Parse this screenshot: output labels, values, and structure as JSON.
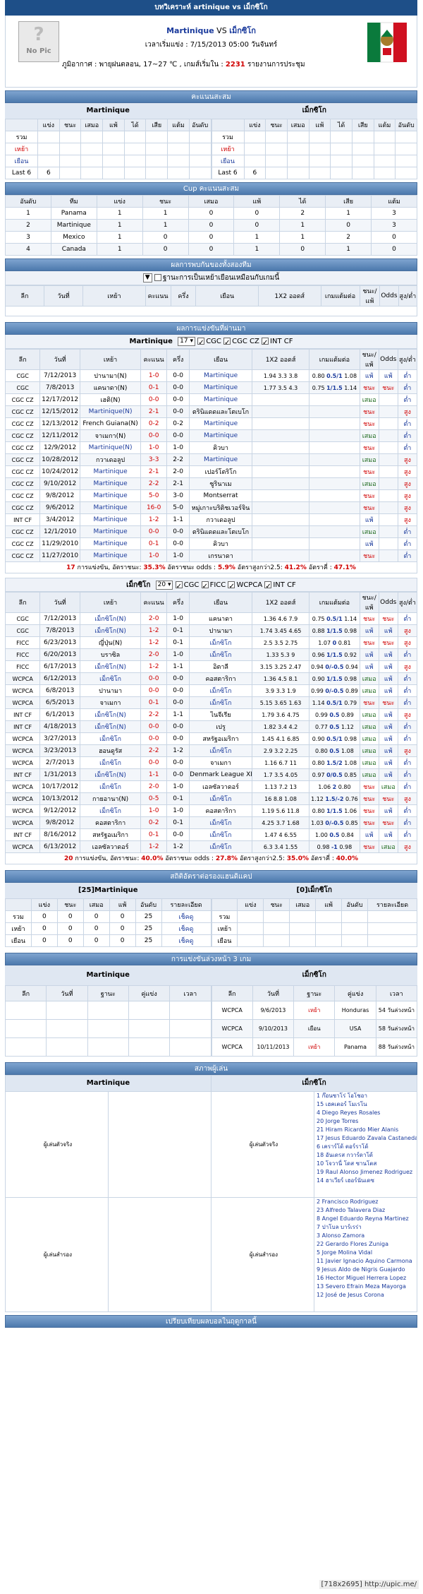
{
  "top_title": "บทวิเคราะห์ artinique vs เม็กซิโก",
  "match": {
    "home": "Martinique",
    "vs": "VS",
    "away": "เม็กซิโก",
    "kick_label": "เวลาเริ่มแข่ง : 7/15/2013 05:00 วันจันทร์",
    "weather_label": "ภูมิอากาศ : พายุฝนตลอน, 17~27 ℃ , เกมส์เริ่มใน :",
    "weather_count": "2231",
    "weather_suffix": "รายงานการประชุม",
    "nopic_q": "?",
    "nopic_label": "No Pic"
  },
  "standings": {
    "title": "คะแนนสะสม",
    "home_team": "Martinique",
    "away_team": "เม็กซิโก",
    "cols": [
      "แข่ง",
      "ชนะ",
      "เสมอ",
      "แพ้",
      "ได้",
      "เสีย",
      "แต้ม",
      "อันดับ"
    ],
    "rows": [
      "รวม",
      "เหย้า",
      "เยือน",
      "Last 6"
    ],
    "last6": "6"
  },
  "cup": {
    "title": "Cup คะแนนสะสม",
    "cols": [
      "อันดับ",
      "ทีม",
      "แข่ง",
      "ชนะ",
      "เสมอ",
      "แพ้",
      "ได้",
      "เสีย",
      "แต้ม"
    ],
    "rows": [
      [
        "1",
        "Panama",
        "1",
        "1",
        "0",
        "0",
        "2",
        "1",
        "3"
      ],
      [
        "2",
        "Martinique",
        "1",
        "1",
        "0",
        "0",
        "1",
        "0",
        "3"
      ],
      [
        "3",
        "Mexico",
        "1",
        "0",
        "0",
        "1",
        "1",
        "2",
        "0"
      ],
      [
        "4",
        "Canada",
        "1",
        "0",
        "0",
        "1",
        "0",
        "1",
        "0"
      ]
    ]
  },
  "h2h": {
    "title": "ผลการพบกันของทั้งสองทีม",
    "option": "ฐานะการเป็นเหย้าเยือนเหมือนกับเกมนี้",
    "cols": [
      "ลีก",
      "วันที่",
      "เหย้า",
      "คะแนน",
      "ครึ่ง",
      "เยือน",
      "1X2 ออดส์",
      "เกมแต้มต่อ",
      "ชนะ/แพ้",
      "Odds",
      "สูง/ต่ำ"
    ]
  },
  "recent": {
    "title": "ผลการแข่งขันที่ผ่านมา",
    "home": {
      "team": "Martinique",
      "n": "17",
      "filters": [
        "CGC",
        "CGC CZ",
        "INT CF"
      ],
      "cols": [
        "ลีก",
        "วันที่",
        "เหย้า",
        "คะแนน",
        "ครึ่ง",
        "เยือน",
        "1X2 ออดส์",
        "เกมแต้มต่อ",
        "ชนะ/แพ้",
        "Odds",
        "สูง/ต่ำ"
      ],
      "rows": [
        [
          "CGC",
          "7/12/2013",
          "ปานามา(N)",
          "1-0",
          "0-0",
          "Martinique",
          "1.94",
          "3.3",
          "3.8",
          "0.80",
          "0.5/1",
          "1.08",
          "แพ้",
          "แพ้",
          "ต่ำ"
        ],
        [
          "CGC",
          "7/8/2013",
          "แคนาดา(N)",
          "0-1",
          "0-0",
          "Martinique",
          "1.77",
          "3.5",
          "4.3",
          "0.75",
          "1/1.5",
          "1.14",
          "ชนะ",
          "ชนะ",
          "ต่ำ"
        ],
        [
          "CGC CZ",
          "12/17/2012",
          "เฮติ(N)",
          "0-0",
          "0-0",
          "Martinique",
          "",
          "",
          "",
          "",
          "",
          "",
          "เสมอ",
          "",
          "ต่ำ"
        ],
        [
          "CGC CZ",
          "12/15/2012",
          "Martinique(N)",
          "2-1",
          "0-0",
          "ตรินิแดดและโตเบโก",
          "",
          "",
          "",
          "",
          "",
          "",
          "ชนะ",
          "",
          "สูง"
        ],
        [
          "CGC CZ",
          "12/13/2012",
          "French Guiana(N)",
          "0-2",
          "0-2",
          "Martinique",
          "",
          "",
          "",
          "",
          "",
          "",
          "ชนะ",
          "",
          "ต่ำ"
        ],
        [
          "CGC CZ",
          "12/11/2012",
          "จาเมกา(N)",
          "0-0",
          "0-0",
          "Martinique",
          "",
          "",
          "",
          "",
          "",
          "",
          "เสมอ",
          "",
          "ต่ำ"
        ],
        [
          "CGC CZ",
          "12/9/2012",
          "Martinique(N)",
          "1-0",
          "1-0",
          "คิวบา",
          "",
          "",
          "",
          "",
          "",
          "",
          "ชนะ",
          "",
          "ต่ำ"
        ],
        [
          "CGC CZ",
          "10/28/2012",
          "กวาเดอลูป",
          "3-3",
          "2-2",
          "Martinique",
          "",
          "",
          "",
          "",
          "",
          "",
          "เสมอ",
          "",
          "สูง"
        ],
        [
          "CGC CZ",
          "10/24/2012",
          "Martinique",
          "2-1",
          "2-0",
          "เปอร์โตริโก",
          "",
          "",
          "",
          "",
          "",
          "",
          "ชนะ",
          "",
          "สูง"
        ],
        [
          "CGC CZ",
          "9/10/2012",
          "Martinique",
          "2-2",
          "2-1",
          "ซูรินาเม",
          "",
          "",
          "",
          "",
          "",
          "",
          "เสมอ",
          "",
          "สูง"
        ],
        [
          "CGC CZ",
          "9/8/2012",
          "Martinique",
          "5-0",
          "3-0",
          "Montserrat",
          "",
          "",
          "",
          "",
          "",
          "",
          "ชนะ",
          "",
          "สูง"
        ],
        [
          "CGC CZ",
          "9/6/2012",
          "Martinique",
          "16-0",
          "5-0",
          "หมู่เกาะบริติชเวอร์จิน",
          "",
          "",
          "",
          "",
          "",
          "",
          "ชนะ",
          "",
          "สูง"
        ],
        [
          "INT CF",
          "3/4/2012",
          "Martinique",
          "1-2",
          "1-1",
          "กวาเดอลูป",
          "",
          "",
          "",
          "",
          "",
          "",
          "แพ้",
          "",
          "สูง"
        ],
        [
          "CGC CZ",
          "12/1/2010",
          "Martinique",
          "0-0",
          "0-0",
          "ตรินิแดดและโตเบโก",
          "",
          "",
          "",
          "",
          "",
          "",
          "เสมอ",
          "",
          "ต่ำ"
        ],
        [
          "CGC CZ",
          "11/29/2010",
          "Martinique",
          "0-1",
          "0-0",
          "คิวบา",
          "",
          "",
          "",
          "",
          "",
          "",
          "แพ้",
          "",
          "ต่ำ"
        ],
        [
          "CGC CZ",
          "11/27/2010",
          "Martinique",
          "1-0",
          "1-0",
          "เกรนาดา",
          "",
          "",
          "",
          "",
          "",
          "",
          "ชนะ",
          "",
          "ต่ำ"
        ]
      ],
      "stats": {
        "p1": "17",
        "t1": "การแข่งขัน, อัตราชนะ:",
        "v1": "35.3%",
        "t2": "อัตราชนะ odds :",
        "v2": "5.9%",
        "t3": "อัตราสูงกว่า2.5:",
        "v3": "41.2%",
        "t4": "อัตราคี่ :",
        "v4": "47.1%"
      }
    },
    "away": {
      "team": "เม็กซิโก",
      "n": "20",
      "filters": [
        "CGC",
        "FICC",
        "WCPCA",
        "INT CF"
      ],
      "cols": [
        "ลีก",
        "วันที่",
        "เหย้า",
        "คะแนน",
        "ครึ่ง",
        "เยือน",
        "1X2 ออดส์",
        "เกมแต้มต่อ",
        "ชนะ/แพ้",
        "Odds",
        "สูง/ต่ำ"
      ],
      "rows": [
        [
          "CGC",
          "7/12/2013",
          "เม็กซิโก(N)",
          "2-0",
          "1-0",
          "แคนาดา",
          "1.36",
          "4.6",
          "7.9",
          "0.75",
          "0.5/1",
          "1.14",
          "ชนะ",
          "ชนะ",
          "ต่ำ"
        ],
        [
          "CGC",
          "7/8/2013",
          "เม็กซิโก(N)",
          "1-2",
          "0-1",
          "ปานามา",
          "1.74",
          "3.45",
          "4.65",
          "0.88",
          "1/1.5",
          "0.98",
          "แพ้",
          "แพ้",
          "สูง"
        ],
        [
          "FICC",
          "6/23/2013",
          "ญี่ปุ่น(N)",
          "1-2",
          "0-1",
          "เม็กซิโก",
          "2.5",
          "3.5",
          "2.75",
          "1.07",
          "0",
          "0.81",
          "ชนะ",
          "ชนะ",
          "สูง"
        ],
        [
          "FICC",
          "6/20/2013",
          "บราซิล",
          "2-0",
          "1-0",
          "เม็กซิโก",
          "1.33",
          "5.3",
          "9",
          "0.96",
          "1/1.5",
          "0.92",
          "แพ้",
          "แพ้",
          "ต่ำ"
        ],
        [
          "FICC",
          "6/17/2013",
          "เม็กซิโก(N)",
          "1-2",
          "1-1",
          "อิตาลี",
          "3.15",
          "3.25",
          "2.47",
          "0.94",
          "0/-0.5",
          "0.94",
          "แพ้",
          "แพ้",
          "สูง"
        ],
        [
          "WCPCA",
          "6/12/2013",
          "เม็กซิโก",
          "0-0",
          "0-0",
          "คอสตาริกา",
          "1.36",
          "4.5",
          "8.1",
          "0.90",
          "1/1.5",
          "0.98",
          "เสมอ",
          "แพ้",
          "ต่ำ"
        ],
        [
          "WCPCA",
          "6/8/2013",
          "ปานามา",
          "0-0",
          "0-0",
          "เม็กซิโก",
          "3.9",
          "3.3",
          "1.9",
          "0.99",
          "0/-0.5",
          "0.89",
          "เสมอ",
          "แพ้",
          "ต่ำ"
        ],
        [
          "WCPCA",
          "6/5/2013",
          "จาเมกา",
          "0-1",
          "0-0",
          "เม็กซิโก",
          "5.15",
          "3.65",
          "1.63",
          "1.14",
          "0.5/1",
          "0.79",
          "ชนะ",
          "ชนะ",
          "ต่ำ"
        ],
        [
          "INT CF",
          "6/1/2013",
          "เม็กซิโก(N)",
          "2-2",
          "1-1",
          "ไนจีเรีย",
          "1.79",
          "3.6",
          "4.75",
          "0.99",
          "0.5",
          "0.89",
          "เสมอ",
          "แพ้",
          "สูง"
        ],
        [
          "INT CF",
          "4/18/2013",
          "เม็กซิโก(N)",
          "0-0",
          "0-0",
          "เปรู",
          "1.82",
          "3.4",
          "4.2",
          "0.77",
          "0.5",
          "1.12",
          "เสมอ",
          "แพ้",
          "ต่ำ"
        ],
        [
          "WCPCA",
          "3/27/2013",
          "เม็กซิโก",
          "0-0",
          "0-0",
          "สหรัฐอเมริกา",
          "1.45",
          "4.1",
          "6.85",
          "0.90",
          "0.5/1",
          "0.98",
          "เสมอ",
          "แพ้",
          "ต่ำ"
        ],
        [
          "WCPCA",
          "3/23/2013",
          "ฮอนดูรัส",
          "2-2",
          "1-2",
          "เม็กซิโก",
          "2.9",
          "3.2",
          "2.25",
          "0.80",
          "0.5",
          "1.08",
          "เสมอ",
          "แพ้",
          "สูง"
        ],
        [
          "WCPCA",
          "2/7/2013",
          "เม็กซิโก",
          "0-0",
          "0-0",
          "จาเมกา",
          "1.16",
          "6.7",
          "11",
          "0.80",
          "1.5/2",
          "1.08",
          "เสมอ",
          "แพ้",
          "ต่ำ"
        ],
        [
          "INT CF",
          "1/31/2013",
          "เม็กซิโก(N)",
          "1-1",
          "0-0",
          "Denmark League XI",
          "1.7",
          "3.5",
          "4.05",
          "0.97",
          "0/0.5",
          "0.85",
          "เสมอ",
          "แพ้",
          "ต่ำ"
        ],
        [
          "WCPCA",
          "10/17/2012",
          "เม็กซิโก",
          "2-0",
          "1-0",
          "เอลซัลวาดอร์",
          "1.13",
          "7.2",
          "13",
          "1.06",
          "2",
          "0.80",
          "ชนะ",
          "เสมอ",
          "ต่ำ"
        ],
        [
          "WCPCA",
          "10/13/2012",
          "กายอานา(N)",
          "0-5",
          "0-1",
          "เม็กซิโก",
          "16",
          "8.8",
          "1.08",
          "1.12",
          "1.5/-2",
          "0.76",
          "ชนะ",
          "ชนะ",
          "สูง"
        ],
        [
          "WCPCA",
          "9/12/2012",
          "เม็กซิโก",
          "1-0",
          "1-0",
          "คอสตาริกา",
          "1.19",
          "5.6",
          "11.8",
          "0.80",
          "1/1.5",
          "1.06",
          "ชนะ",
          "แพ้",
          "ต่ำ"
        ],
        [
          "WCPCA",
          "9/8/2012",
          "คอสตาริกา",
          "0-2",
          "0-1",
          "เม็กซิโก",
          "4.25",
          "3.7",
          "1.68",
          "1.03",
          "0/-0.5",
          "0.85",
          "ชนะ",
          "ชนะ",
          "ต่ำ"
        ],
        [
          "INT CF",
          "8/16/2012",
          "สหรัฐอเมริกา",
          "0-1",
          "0-0",
          "เม็กซิโก",
          "1.47",
          "4",
          "6.55",
          "1.00",
          "0.5",
          "0.84",
          "แพ้",
          "แพ้",
          "ต่ำ"
        ],
        [
          "WCPCA",
          "6/13/2012",
          "เอลซัลวาดอร์",
          "1-2",
          "1-2",
          "เม็กซิโก",
          "6.3",
          "3.4",
          "1.55",
          "0.98",
          "-1",
          "0.98",
          "ชนะ",
          "เสมอ",
          "สูง"
        ]
      ],
      "stats": {
        "p1": "20",
        "t1": "การแข่งขัน, อัตราชนะ:",
        "v1": "40.0%",
        "t2": "อัตราชนะ odds :",
        "v2": "27.8%",
        "t3": "อัตราสูงกว่า2.5:",
        "v3": "35.0%",
        "t4": "อัตราคี่ :",
        "v4": "40.0%"
      }
    }
  },
  "hc": {
    "title": "สถิติอัตราต่อรองแฮนดิแคป",
    "home": "[25]Martinique",
    "away": "[0]เม็กซิโก",
    "cols": [
      "แข่ง",
      "ชนะ",
      "เสมอ",
      "แพ้",
      "อันดับ",
      "รายละเอียด"
    ],
    "rows": [
      [
        "รวม",
        "0",
        "0",
        "0",
        "0",
        "25",
        "เช็คดู"
      ],
      [
        "เหย้า",
        "0",
        "0",
        "0",
        "0",
        "25",
        "เช็คดู"
      ],
      [
        "เยือน",
        "0",
        "0",
        "0",
        "0",
        "25",
        "เช็คดู"
      ]
    ],
    "away_rows": [
      "รวม",
      "เหย้า",
      "เยือน"
    ]
  },
  "next3": {
    "title": "การแข่งขันล่วงหน้า 3 เกม",
    "home": "Martinique",
    "away": "เม็กซิโก",
    "cols": [
      "ลีก",
      "วันที่",
      "ฐานะ",
      "คู่แข่ง",
      "เวลา"
    ],
    "away_rows": [
      [
        "WCPCA",
        "9/6/2013",
        "เหย้า",
        "Honduras",
        "54 วันล่วงหน้า"
      ],
      [
        "WCPCA",
        "9/10/2013",
        "เยือน",
        "USA",
        "58 วันล่วงหน้า"
      ],
      [
        "WCPCA",
        "10/11/2013",
        "เหย้า",
        "Panama",
        "88 วันล่วงหน้า"
      ]
    ]
  },
  "lineup": {
    "title": "สภาพผู้เล่น",
    "home": "Martinique",
    "away": "เม็กซิโก",
    "starter_lbl": "ผู้เล่นตัวจริง",
    "sub_lbl": "ผู้เล่นสำรอง",
    "away_starters": [
      "1 ก๊อนซาโร่ โอโชอา",
      "15 เฮคเตอร์ โมเรโน",
      "4 Diego Reyes Rosales",
      "20 Jorge Torres",
      "21 Hiram Ricardo Mier Alanis",
      "17 Jesus Eduardo Zavala Castaneda",
      "6 เคราร์โด้ ตอร์ราโด้",
      "18 อันเดรส กวาร์ดาโด้",
      "10 โจวานี่ โดส ซานโตส",
      "19 Raul Alonso Jimenez Rodriguez",
      "14 ฮาเวียร์ เฮอร์นันเดซ"
    ],
    "away_subs": [
      "2 Francisco Rodriguez",
      "23 Alfredo Talavera Diaz",
      "8 Angel Eduardo Reyna Martinez",
      "7 ปาโบล บาร์เรร่า",
      "3 Alonso Zamora",
      "22 Gerardo Flores Zuniga",
      "5 Jorge Molina Vidal",
      "11 Javier Ignacio Aquino Carmona",
      "9 Jesus Aldo de Nigris Guajardo",
      "16 Hector Miguel Herrera Lopez",
      "13 Severo Efrain Meza Mayorga",
      "12 José de Jesus Corona"
    ]
  },
  "compare_title": "เปรียบเทียบผลบอลในฤดูกาลนี้",
  "footer": "[718x2695] http://upic.me/"
}
